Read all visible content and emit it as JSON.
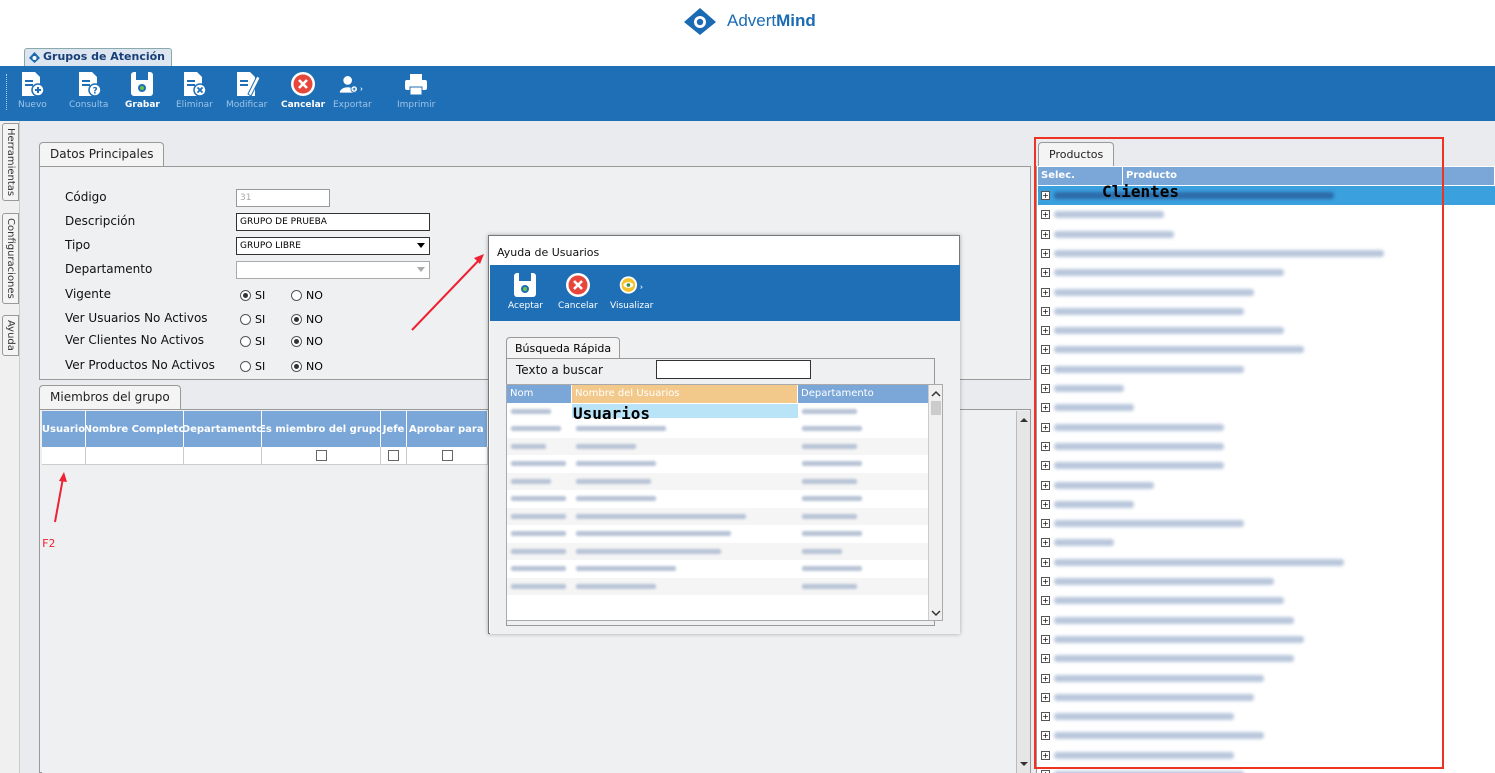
{
  "brand": {
    "name_light": "Advert",
    "name_bold": "Mind"
  },
  "main_tab": {
    "label": "Grupos de Atención"
  },
  "toolbar": {
    "nuevo": "Nuevo",
    "consulta": "Consulta",
    "grabar": "Grabar",
    "eliminar": "Eliminar",
    "modificar": "Modificar",
    "cancelar": "Cancelar",
    "exportar": "Exportar",
    "imprimir": "Imprimir"
  },
  "side_tabs": {
    "herramientas": "Herramientas",
    "configuraciones": "Configuraciones",
    "ayuda": "Ayuda"
  },
  "datos": {
    "tab_label": "Datos Principales",
    "codigo_label": "Código",
    "codigo_value": "31",
    "descripcion_label": "Descripción",
    "descripcion_value": "GRUPO DE PRUEBA",
    "tipo_label": "Tipo",
    "tipo_value": "GRUPO LIBRE",
    "departamento_label": "Departamento",
    "departamento_value": "",
    "vigente_label": "Vigente",
    "ver_usuarios_label": "Ver Usuarios No Activos",
    "ver_clientes_label": "Ver Clientes No Activos",
    "ver_productos_label": "Ver Productos No Activos",
    "si": "SI",
    "no": "NO"
  },
  "miembros": {
    "tab_label": "Miembros del grupo",
    "columns": [
      "Usuario",
      "Nombre Completo",
      "Departamento",
      "Es miembro del grupo",
      "Jefe",
      "Aprobar para Fa"
    ],
    "annotation": "F2"
  },
  "productos": {
    "tab_label": "Productos",
    "columns": [
      "Selec.",
      "Producto"
    ],
    "overlay_label": "Clientes"
  },
  "modal": {
    "title": "Ayuda de Usuarios",
    "aceptar": "Aceptar",
    "cancelar": "Cancelar",
    "visualizar": "Visualizar",
    "search_tab": "Búsqueda Rápida",
    "search_label": "Texto a buscar",
    "search_value": "",
    "columns": [
      "Nom",
      "Nombre del Usuarios",
      "Departamento"
    ],
    "overlay_label": "Usuarios"
  },
  "colors": {
    "toolbar": "#1f6fb6",
    "grid_header": "#7aa7d8",
    "highlight": "#f2c98a",
    "annotation": "#e23333"
  }
}
